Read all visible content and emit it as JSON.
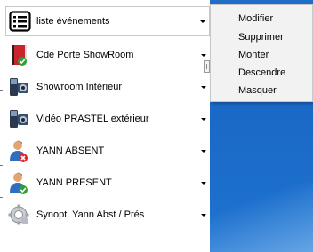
{
  "list": {
    "items": [
      {
        "label": "liste événements",
        "icon": "list-icon"
      },
      {
        "label": "Cde Porte ShowRoom",
        "icon": "door-icon"
      },
      {
        "label": "Showroom Intérieur",
        "icon": "camera-icon"
      },
      {
        "label": "Vidéo PRASTEL extérieur",
        "icon": "camera-icon"
      },
      {
        "label": "YANN ABSENT",
        "icon": "user-absent-icon"
      },
      {
        "label": "YANN PRESENT",
        "icon": "user-present-icon"
      },
      {
        "label": "Synopt. Yann Abst / Prés",
        "icon": "gear-icon"
      }
    ]
  },
  "context_menu": {
    "items": [
      "Modifier",
      "Supprimer",
      "Monter",
      "Descendre",
      "Masquer"
    ]
  },
  "colors": {
    "desktop": "#1a68c6",
    "status_ok": "#2e9f35",
    "status_error": "#d9262d"
  }
}
